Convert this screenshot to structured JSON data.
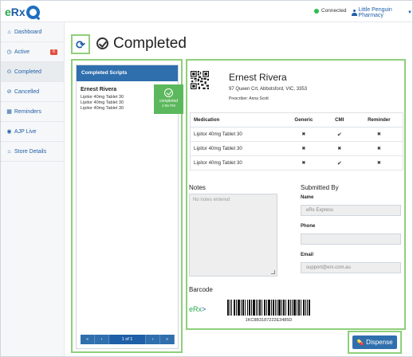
{
  "header": {
    "logo": {
      "e": "e",
      "rx": "Rx"
    },
    "connection_status": "Connected",
    "pharmacy_name": "Little Penguin Pharmacy",
    "status_color": "#2ebd4e"
  },
  "sidebar": {
    "items": [
      {
        "label": "Dashboard",
        "icon": "home-icon"
      },
      {
        "label": "Active",
        "icon": "clock-icon",
        "badge": "6"
      },
      {
        "label": "Completed",
        "icon": "check-circle-icon",
        "active": true
      },
      {
        "label": "Cancelled",
        "icon": "ban-icon"
      },
      {
        "label": "Reminders",
        "icon": "calendar-icon"
      },
      {
        "label": "AJP Live",
        "icon": "globe-icon"
      },
      {
        "label": "Store Details",
        "icon": "home-icon"
      }
    ]
  },
  "page": {
    "title": "Completed"
  },
  "scripts_panel": {
    "heading": "Completed Scripts",
    "scripts": [
      {
        "patient": "Ernest Rivera",
        "medications": [
          "Lipitor 40mg Tablet 30",
          "Lipitor 40mg Tablet 30",
          "Lipitor 40mg Tablet 30"
        ],
        "status": "completed",
        "time": "4:56 PM"
      }
    ],
    "pager": {
      "first": "«",
      "prev": "‹",
      "current": "1 of 1",
      "next": "›",
      "last": "»"
    }
  },
  "detail": {
    "patient_name": "Ernest Rivera",
    "address": "97 Queen Crt, Abbotsford, VIC, 3353",
    "prescriber": "Prescriber: Anna Scott",
    "table": {
      "headers": [
        "Medication",
        "Generic",
        "CMI",
        "Reminder"
      ],
      "rows": [
        {
          "medication": "Lipitor 40mg Tablet 30",
          "generic": "✖",
          "cmi": "✔",
          "reminder": "✖"
        },
        {
          "medication": "Lipitor 40mg Tablet 30",
          "generic": "✖",
          "cmi": "✖",
          "reminder": "✖"
        },
        {
          "medication": "Lipitor 40mg Tablet 30",
          "generic": "✖",
          "cmi": "✔",
          "reminder": "✖"
        }
      ]
    },
    "notes": {
      "title": "Notes",
      "placeholder": "No notes entered"
    },
    "submitted_by": {
      "title": "Submitted By",
      "name_label": "Name",
      "name_value": "eRx Express",
      "phone_label": "Phone",
      "phone_value": "",
      "email_label": "Email",
      "email_value": "support@erx.com.au"
    },
    "barcode": {
      "title": "Barcode",
      "logo_e": "eRx",
      "logo_arrow": ">",
      "number": "1KC8B3187222E3485D"
    }
  },
  "actions": {
    "dispense_label": "Dispense"
  }
}
